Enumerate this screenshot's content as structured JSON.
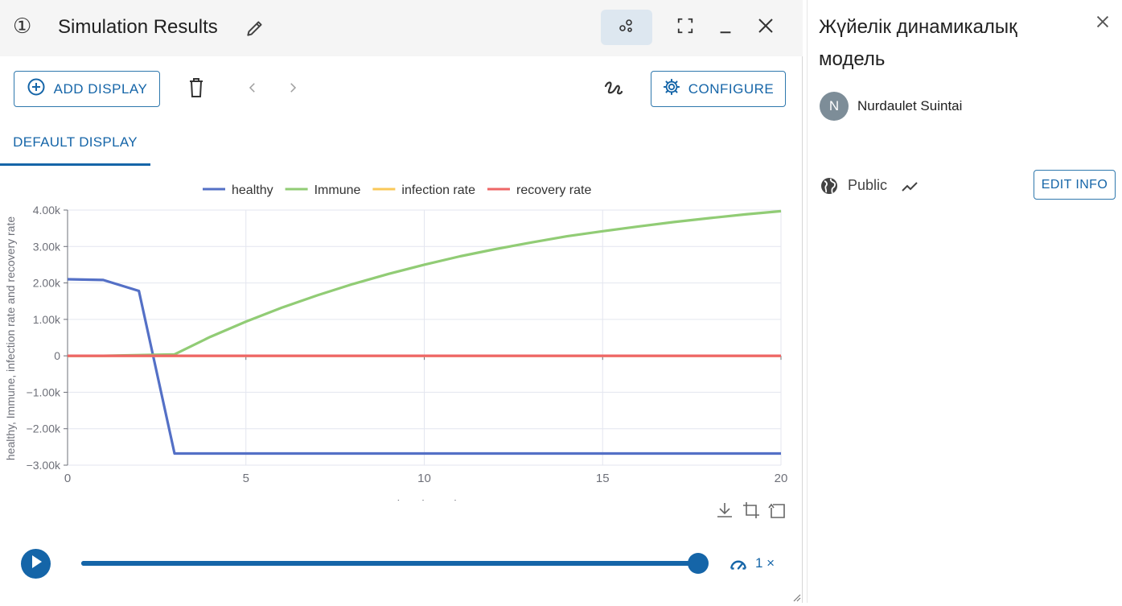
{
  "window": {
    "number": "①",
    "title": "Simulation Results"
  },
  "toolbar": {
    "add_display_label": "ADD DISPLAY",
    "configure_label": "CONFIGURE"
  },
  "tabs": [
    {
      "label": "DEFAULT DISPLAY",
      "active": true
    }
  ],
  "chart_data": {
    "type": "line",
    "xlabel": "Time (Years)",
    "ylabel": "healthy, Immune, infection rate and recovery rate",
    "x_ticks": [
      "0",
      "5",
      "10",
      "15",
      "20"
    ],
    "y_ticks": [
      "4.00k",
      "3.00k",
      "2.00k",
      "1.00k",
      "0",
      "−1.00k",
      "−2.00k",
      "−3.00k"
    ],
    "xlim": [
      0,
      20
    ],
    "ylim": [
      -3000,
      4000
    ],
    "grid": true,
    "legend_position": "top",
    "series": [
      {
        "name": "healthy",
        "color": "#5470c6",
        "x": [
          0,
          1,
          2,
          3,
          4,
          5,
          6,
          7,
          8,
          9,
          10,
          11,
          12,
          13,
          14,
          15,
          16,
          17,
          18,
          19,
          20
        ],
        "y": [
          2100,
          2080,
          1780,
          -2680,
          -2680,
          -2680,
          -2680,
          -2680,
          -2680,
          -2680,
          -2680,
          -2680,
          -2680,
          -2680,
          -2680,
          -2680,
          -2680,
          -2680,
          -2680,
          -2680,
          -2680
        ]
      },
      {
        "name": "Immune",
        "color": "#91cc75",
        "x": [
          0,
          1,
          2,
          3,
          4,
          5,
          6,
          7,
          8,
          9,
          10,
          11,
          12,
          13,
          14,
          15,
          16,
          17,
          18,
          19,
          20
        ],
        "y": [
          0,
          0,
          20,
          40,
          520,
          940,
          1320,
          1660,
          1970,
          2250,
          2500,
          2730,
          2930,
          3110,
          3280,
          3420,
          3550,
          3670,
          3780,
          3880,
          3970
        ]
      },
      {
        "name": "infection rate",
        "color": "#fac858",
        "x": [
          0,
          1,
          2,
          3,
          4,
          5,
          6,
          7,
          8,
          9,
          10,
          11,
          12,
          13,
          14,
          15,
          16,
          17,
          18,
          19,
          20
        ],
        "y": [
          0,
          0,
          0,
          0,
          0,
          0,
          0,
          0,
          0,
          0,
          0,
          0,
          0,
          0,
          0,
          0,
          0,
          0,
          0,
          0,
          0
        ]
      },
      {
        "name": "recovery rate",
        "color": "#ee6666",
        "x": [
          0,
          1,
          2,
          3,
          4,
          5,
          6,
          7,
          8,
          9,
          10,
          11,
          12,
          13,
          14,
          15,
          16,
          17,
          18,
          19,
          20
        ],
        "y": [
          0,
          0,
          0,
          0,
          0,
          0,
          0,
          0,
          0,
          0,
          0,
          0,
          0,
          0,
          0,
          0,
          0,
          0,
          0,
          0,
          0
        ]
      }
    ]
  },
  "player": {
    "progress": 1.0,
    "speed_label": "1 ×"
  },
  "panel": {
    "title": "Жүйелік динамикалық модель",
    "author_initial": "N",
    "author_name": "Nurdaulet Suintai",
    "visibility": "Public",
    "edit_info_label": "EDIT INFO"
  },
  "colors": {
    "accent": "#1565a8",
    "share_button_bg": "#dde7f0"
  }
}
